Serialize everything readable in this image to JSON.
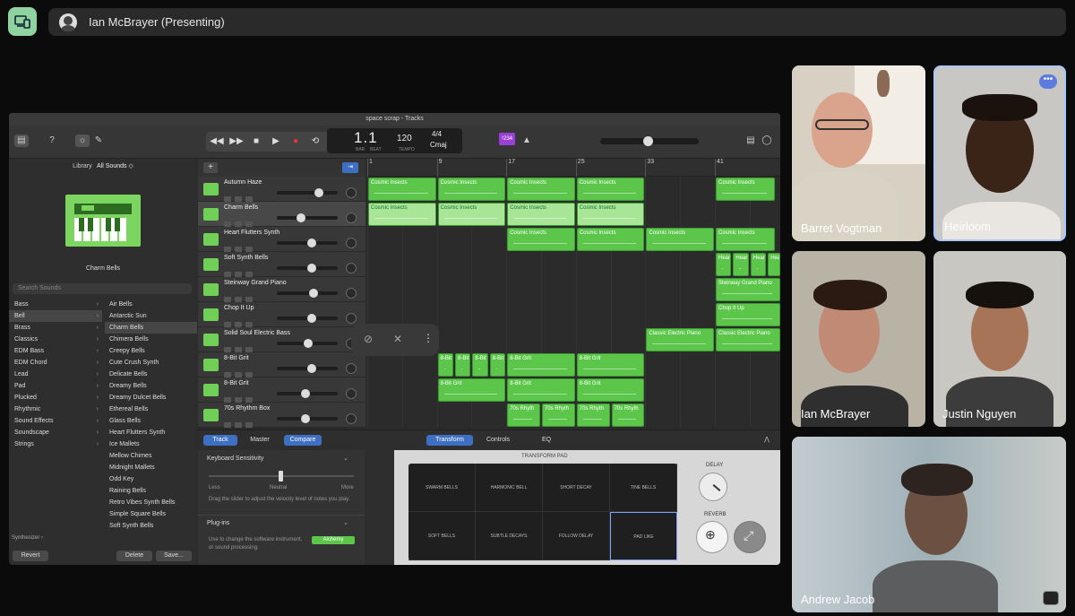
{
  "presenter": {
    "name": "Ian McBrayer (Presenting)"
  },
  "gb": {
    "window_title": "space scrap - Tracks",
    "lcd": {
      "position": "1.1",
      "bar_label": "BAR",
      "beat_label": "BEAT",
      "tempo": "120",
      "tempo_label": "TEMPO",
      "signature": "4/4",
      "key": "Cmaj"
    },
    "badge": "¹234",
    "library": {
      "title": "Library",
      "filter": "All Sounds ◇",
      "instrument": "Charm Bells",
      "search_placeholder": "Search Sounds",
      "categories": [
        "Bass",
        "Bell",
        "Brass",
        "Classics",
        "EDM Bass",
        "EDM Chord",
        "Lead",
        "Pad",
        "Plucked",
        "Rhythmic",
        "Sound Effects",
        "Soundscape",
        "Strings"
      ],
      "selected_category": 1,
      "sounds": [
        "Air Bells",
        "Antarctic Sun",
        "Charm Bells",
        "Chimera Bells",
        "Creepy Bells",
        "Cute Crush Synth",
        "Delicate Bells",
        "Dreamy Bells",
        "Dreamy Dulcet Bells",
        "Ethereal Bells",
        "Glass Bells",
        "Heart Flutters Synth",
        "Ice Mallets",
        "Mellow Chimes",
        "Midnight Mallets",
        "Odd Key",
        "Raining Bells",
        "Retro Vibes Synth Bells",
        "Simple Square Bells",
        "Soft Synth Bells"
      ],
      "selected_sound": 2,
      "footer": "Synthesizer ›",
      "revert": "Revert",
      "delete": "Delete",
      "save": "Save..."
    },
    "ruler": [
      "1",
      "9",
      "17",
      "25",
      "33",
      "41"
    ],
    "tracks": [
      {
        "name": "Autumn Haze",
        "vol": 0.72
      },
      {
        "name": "Charm Bells",
        "vol": 0.38
      },
      {
        "name": "Heart Flutters Synth",
        "vol": 0.58
      },
      {
        "name": "Soft Synth Bells",
        "vol": 0.58
      },
      {
        "name": "Steinway Grand Piano",
        "vol": 0.62
      },
      {
        "name": "Chop It Up",
        "vol": 0.58
      },
      {
        "name": "Solid Soul Electric Bass",
        "vol": 0.52
      },
      {
        "name": "8-Bit Grit",
        "vol": 0.58
      },
      {
        "name": "8-Bit Grit",
        "vol": 0.46
      },
      {
        "name": "70s Rhythm Box",
        "vol": 0.46
      }
    ],
    "region_labels": {
      "cosmic": "Cosmic Insects",
      "hear": "Hear",
      "steinway": "Steinway Grand Piano",
      "chop": "Chop It Up",
      "classic": "Classic Electric Piano",
      "grit": "8-Bit Grit",
      "grit_short": "8-Bit",
      "rhythm": "70s Rhyth"
    },
    "editor": {
      "tabs": [
        "Track",
        "Master",
        "Compare"
      ],
      "panel_tabs": [
        "Transform",
        "Controls",
        "EQ"
      ],
      "keyboard_sensitivity": "Keyboard Sensitivity",
      "less": "Less",
      "neutral": "Neutral",
      "more": "More",
      "sens_desc": "Drag the slider to adjust the velocity level of notes you play.",
      "plugins": "Plug-ins",
      "plugins_desc": "Use to change the software instrument, or sound processing.",
      "alchemy": "Alchemy",
      "transform_pad": "TRANSFORM PAD",
      "cells": [
        "SWARM BELLS",
        "HARMONIC BELL",
        "SHORT DECAY",
        "TINE BELLS",
        "SOFT BELLS",
        "SUBTLE DECAYS",
        "FOLLOW DELAY",
        "PAD LIKE"
      ],
      "delay": "DELAY",
      "reverb": "REVERB"
    }
  },
  "participants": [
    {
      "name": "Barret Vogtman"
    },
    {
      "name": "Heirloom"
    },
    {
      "name": "Ian McBrayer"
    },
    {
      "name": "Justin Nguyen"
    },
    {
      "name": "Andrew Jacob"
    }
  ]
}
